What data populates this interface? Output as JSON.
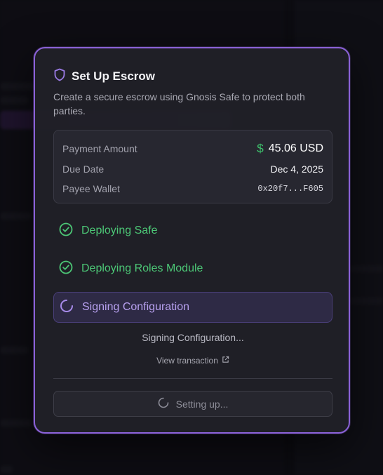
{
  "modal": {
    "title": "Set Up Escrow",
    "description": "Create a secure escrow using Gnosis Safe to protect both parties."
  },
  "details": {
    "payment_amount_label": "Payment Amount",
    "payment_amount_value": "45.06 USD",
    "currency_symbol": "$",
    "due_date_label": "Due Date",
    "due_date_value": "Dec 4, 2025",
    "payee_wallet_label": "Payee Wallet",
    "payee_wallet_value": "0x20f7...F605"
  },
  "steps": [
    {
      "label": "Deploying Safe",
      "state": "done",
      "icon": "check-circle-icon"
    },
    {
      "label": "Deploying Roles Module",
      "state": "done",
      "icon": "check-circle-icon"
    },
    {
      "label": "Signing Configuration",
      "state": "active",
      "icon": "spinner-icon"
    }
  ],
  "status_text": "Signing Configuration...",
  "view_transaction_label": "View transaction",
  "action_button_label": "Setting up...",
  "colors": {
    "accent": "#8b62d8",
    "success": "#4cc776",
    "active_text": "#b7a0ef"
  }
}
